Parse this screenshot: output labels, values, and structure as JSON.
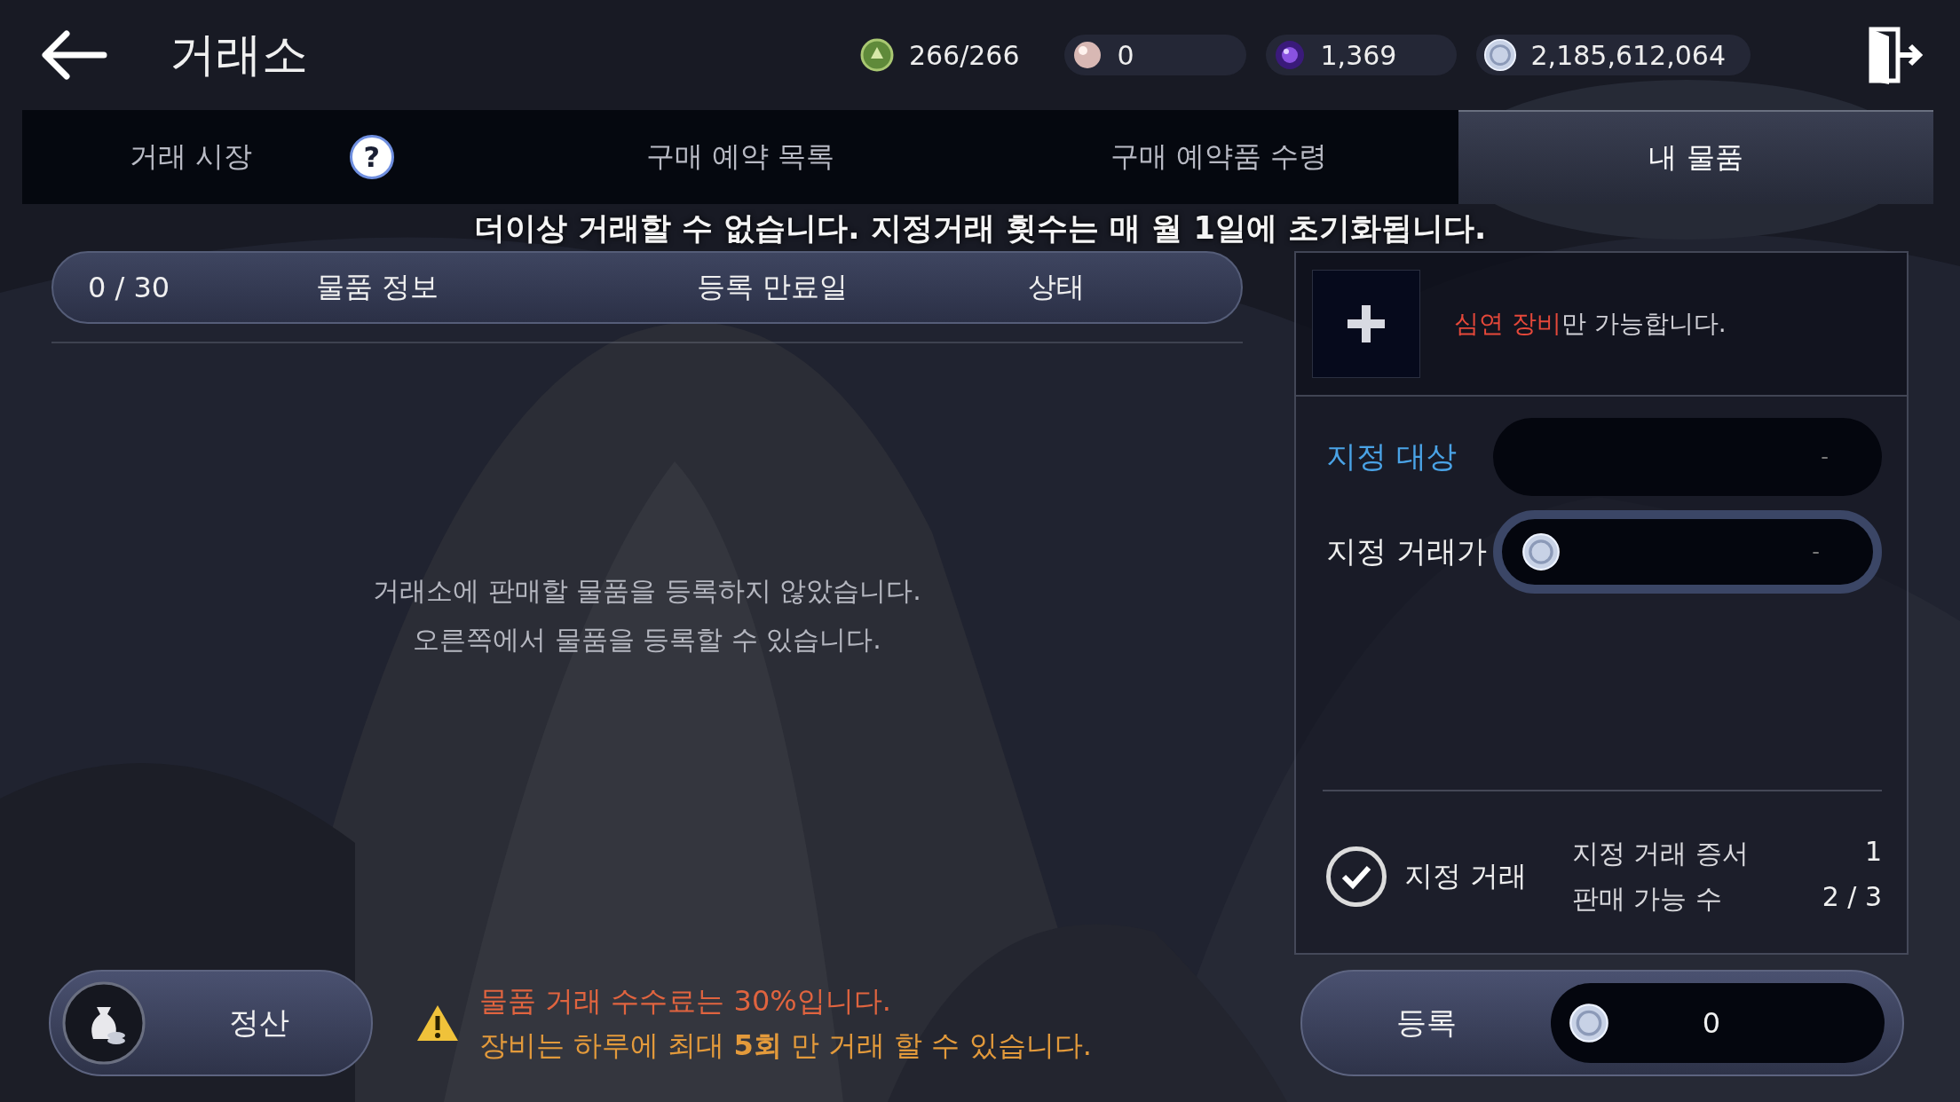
{
  "header": {
    "title": "거래소"
  },
  "currencies": [
    {
      "kind": "stamina",
      "value": "266/266"
    },
    {
      "kind": "pearl",
      "value": "0"
    },
    {
      "kind": "orb",
      "value": "1,369"
    },
    {
      "kind": "silver",
      "value": "2,185,612,064"
    }
  ],
  "tabs": [
    {
      "label": "거래 시장",
      "selected": false,
      "help": "?"
    },
    {
      "label": "구매 예약 목록",
      "selected": false
    },
    {
      "label": "구매 예약품 수령",
      "selected": false
    },
    {
      "label": "내 물품",
      "selected": true
    }
  ],
  "notice": "더이상 거래할 수 없습니다. 지정거래 횟수는 매 월 1일에 초기화됩니다.",
  "list": {
    "count": "0 / 30",
    "columns": [
      "물품 정보",
      "등록 만료일",
      "상태"
    ],
    "empty_message": [
      "거래소에 판매할 물품을 등록하지 않았습니다.",
      "오른쪽에서 물품을 등록할 수 있습니다."
    ]
  },
  "register_panel": {
    "slot_hint": {
      "highlight": "심연 장비",
      "rest": "만 가능합니다."
    },
    "fields": [
      {
        "kind": "target",
        "label": "지정 대상",
        "value": "-"
      },
      {
        "kind": "price",
        "label": "지정 거래가",
        "value": "-"
      }
    ],
    "designated_trade": {
      "label": "지정 거래",
      "checked": true
    },
    "stats": [
      {
        "label": "지정 거래 증서",
        "value": "1"
      },
      {
        "label": "판매 가능 수",
        "value": "2 / 3"
      }
    ]
  },
  "settle_button": {
    "label": "정산"
  },
  "warnings": [
    {
      "text": "물품 거래 수수료는 30%입니다.",
      "color": "#e0643f"
    },
    {
      "text": "장비는 하루에 최대 **5회** 만 거래 할 수 있습니다.",
      "color": "#e39a3b"
    }
  ],
  "register_button": {
    "label": "등록",
    "price": "0"
  }
}
